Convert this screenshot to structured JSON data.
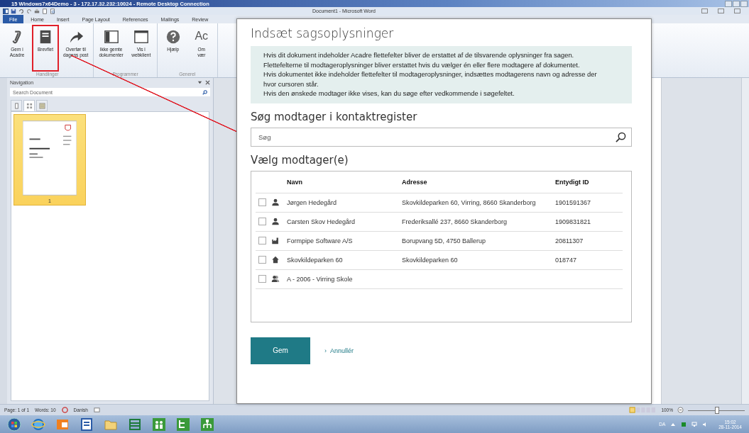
{
  "remote_window": {
    "title": "15 Windows7x64Demo - 3 - 172.17.32.232:10024 - Remote Desktop Connection"
  },
  "word": {
    "title": "Document1 - Microsoft Word",
    "file_tab": "File",
    "tabs": [
      "Home",
      "Insert",
      "Page Layout",
      "References",
      "Mailings",
      "Review"
    ],
    "ribbon_groups": [
      {
        "label": "Handlinger",
        "buttons": [
          {
            "label": "Gem i\nAcadre",
            "annotated": false
          },
          {
            "label": "Brevflet",
            "annotated": true
          },
          {
            "label": "Overfør til\ndagens post",
            "annotated": false
          }
        ]
      },
      {
        "label": "Programmer",
        "buttons": [
          {
            "label": "Ikke gemte\ndokumenter",
            "annotated": false
          },
          {
            "label": "Vis i\nwebklient",
            "annotated": false
          }
        ]
      },
      {
        "label": "Generel",
        "buttons": [
          {
            "label": "Hjælp",
            "annotated": false
          },
          {
            "label": "Om\nvær",
            "icon_text": "Ac",
            "annotated": false
          }
        ]
      }
    ]
  },
  "navigation": {
    "title": "Navigation",
    "search": {
      "placeholder": "Search Document"
    },
    "view_tabs": [
      {
        "selected": false
      },
      {
        "selected": true
      },
      {
        "selected": false
      }
    ],
    "pages": [
      {
        "label": "1",
        "selected": true
      }
    ]
  },
  "status_bar": {
    "items": [
      "Page: 1 of 1",
      "Words: 10",
      "Danish"
    ],
    "zoom": "100%",
    "zoom_slider": {
      "level": 0.5
    }
  },
  "taskbar": {
    "language": "DA",
    "time": "15:02",
    "date": "28-11-2014"
  },
  "dialog": {
    "title": "Indsæt sagsoplysninger",
    "info": [
      "Hvis dit dokument indeholder Acadre flettefelter bliver de erstattet af de tilsvarende oplysninger fra sagen.",
      "Flettefelterne til modtageroplysninger bliver erstattet hvis du vælger én eller flere modtagere af dokumentet.",
      "Hvis dokumentet ikke indeholder flettefelter til modtageroplysninger, indsættes modtagerens navn og adresse der hvor cursoren står.",
      "Hvis den ønskede modtager ikke vises, kan du søge efter vedkommende i søgefeltet."
    ],
    "search_heading": "Søg modtager i kontaktregister",
    "search": {
      "placeholder": "Søg"
    },
    "recipients_heading": "Vælg modtager(e)",
    "columns": [
      "Navn",
      "Adresse",
      "Entydigt ID"
    ],
    "rows": [
      {
        "kind": "person",
        "checked": false,
        "name": "Jørgen Hedegård",
        "address": "Skovkildeparken 60, Virring, 8660 Skanderborg",
        "id": "1901591367"
      },
      {
        "kind": "person",
        "checked": false,
        "name": "Carsten Skov Hedegård",
        "address": "Frederiksallé 237, 8660 Skanderborg",
        "id": "1909831821"
      },
      {
        "kind": "company",
        "checked": false,
        "name": "Formpipe Software A/S",
        "address": "Borupvang 5D, 4750 Ballerup",
        "id": "20811307"
      },
      {
        "kind": "address",
        "checked": false,
        "name": "Skovkildeparken 60",
        "address": "Skovkildeparken 60",
        "id": "018747"
      },
      {
        "kind": "group",
        "checked": false,
        "name": "A - 2006 - Virring Skole"
      }
    ],
    "save_button": "Gem",
    "cancel_link": "Annullér",
    "cancel_mark": "›"
  }
}
